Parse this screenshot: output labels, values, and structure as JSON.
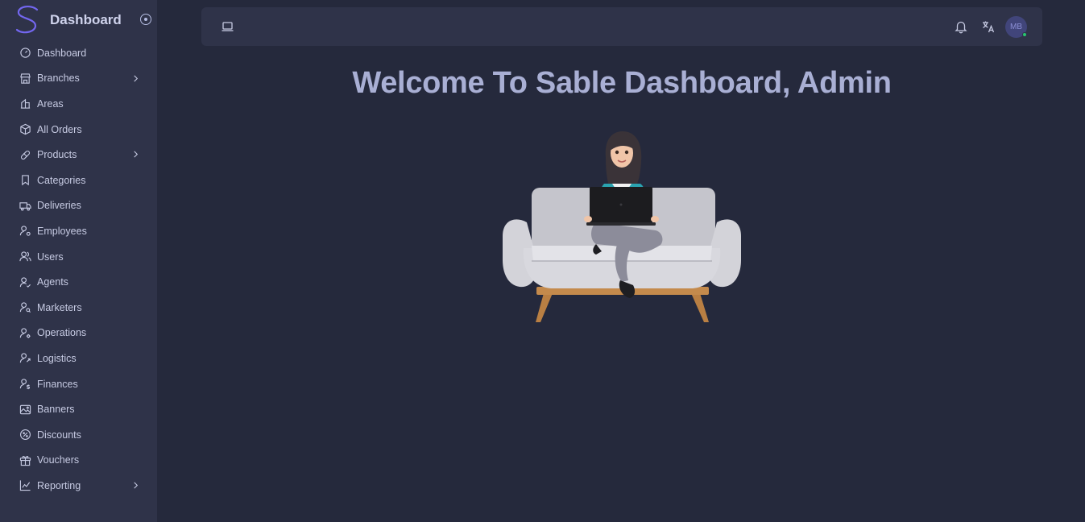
{
  "app": {
    "title": "Dashboard"
  },
  "sidebar": {
    "items": [
      {
        "label": "Dashboard",
        "icon": "gauge-icon",
        "has_submenu": false
      },
      {
        "label": "Branches",
        "icon": "store-icon",
        "has_submenu": true
      },
      {
        "label": "Areas",
        "icon": "building-icon",
        "has_submenu": false
      },
      {
        "label": "All Orders",
        "icon": "package-icon",
        "has_submenu": false
      },
      {
        "label": "Products",
        "icon": "pill-icon",
        "has_submenu": true
      },
      {
        "label": "Categories",
        "icon": "bookmark-icon",
        "has_submenu": false
      },
      {
        "label": "Deliveries",
        "icon": "truck-icon",
        "has_submenu": false
      },
      {
        "label": "Employees",
        "icon": "user-gear-icon",
        "has_submenu": false
      },
      {
        "label": "Users",
        "icon": "users-icon",
        "has_submenu": false
      },
      {
        "label": "Agents",
        "icon": "user-check-icon",
        "has_submenu": false
      },
      {
        "label": "Marketers",
        "icon": "user-search-icon",
        "has_submenu": false
      },
      {
        "label": "Operations",
        "icon": "user-cog-icon",
        "has_submenu": false
      },
      {
        "label": "Logistics",
        "icon": "user-share-icon",
        "has_submenu": false
      },
      {
        "label": "Finances",
        "icon": "user-dollar-icon",
        "has_submenu": false
      },
      {
        "label": "Banners",
        "icon": "image-icon",
        "has_submenu": false
      },
      {
        "label": "Discounts",
        "icon": "discount-icon",
        "has_submenu": false
      },
      {
        "label": "Vouchers",
        "icon": "gift-icon",
        "has_submenu": false
      },
      {
        "label": "Reporting",
        "icon": "chart-icon",
        "has_submenu": true
      }
    ]
  },
  "topbar": {
    "user_initials": "MB",
    "user_status": "online"
  },
  "main": {
    "welcome": "Welcome To Sable Dashboard, Admin"
  },
  "colors": {
    "background": "#25293c",
    "surface": "#2f3349",
    "accent": "#7367f0",
    "text": "#b6bee3",
    "online": "#28c76f"
  }
}
